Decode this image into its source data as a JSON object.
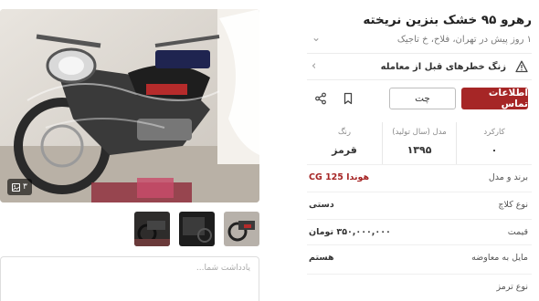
{
  "ad": {
    "title": "رهرو ۹۵ خشک بنزین نریخته",
    "subtitle": "۱ روز پیش در تهران، فلاح، خ تاجیک"
  },
  "warning": {
    "text": "زنگ خطرهای قبل از معامله"
  },
  "actions": {
    "contact_label": "اطلاعات تماس",
    "chat_label": "چت",
    "bookmark_icon": "bookmark-icon",
    "share_icon": "share-icon"
  },
  "stats": [
    {
      "label": "کارکرد",
      "value": "۰"
    },
    {
      "label": "مدل (سال تولید)",
      "value": "۱۳۹۵"
    },
    {
      "label": "رنگ",
      "value": "قرمز"
    }
  ],
  "info": [
    {
      "label": "برند و مدل",
      "value": "هوندا CG 125"
    },
    {
      "label": "نوع کلاچ",
      "value": "دستی"
    },
    {
      "label": "قیمت",
      "value": "۳۵۰,۰۰۰,۰۰۰ تومان"
    },
    {
      "label": "مایل به معاوضه",
      "value": "هستم"
    },
    {
      "label": "نوع ترمز",
      "value": ""
    }
  ],
  "gallery": {
    "photo_count": "۳",
    "thumbnail_count": 3
  },
  "note": {
    "placeholder": "یادداشت شما..."
  },
  "colors": {
    "accent": "#a62626",
    "link": "#a62626",
    "muted_text": "#7a7a7a"
  }
}
